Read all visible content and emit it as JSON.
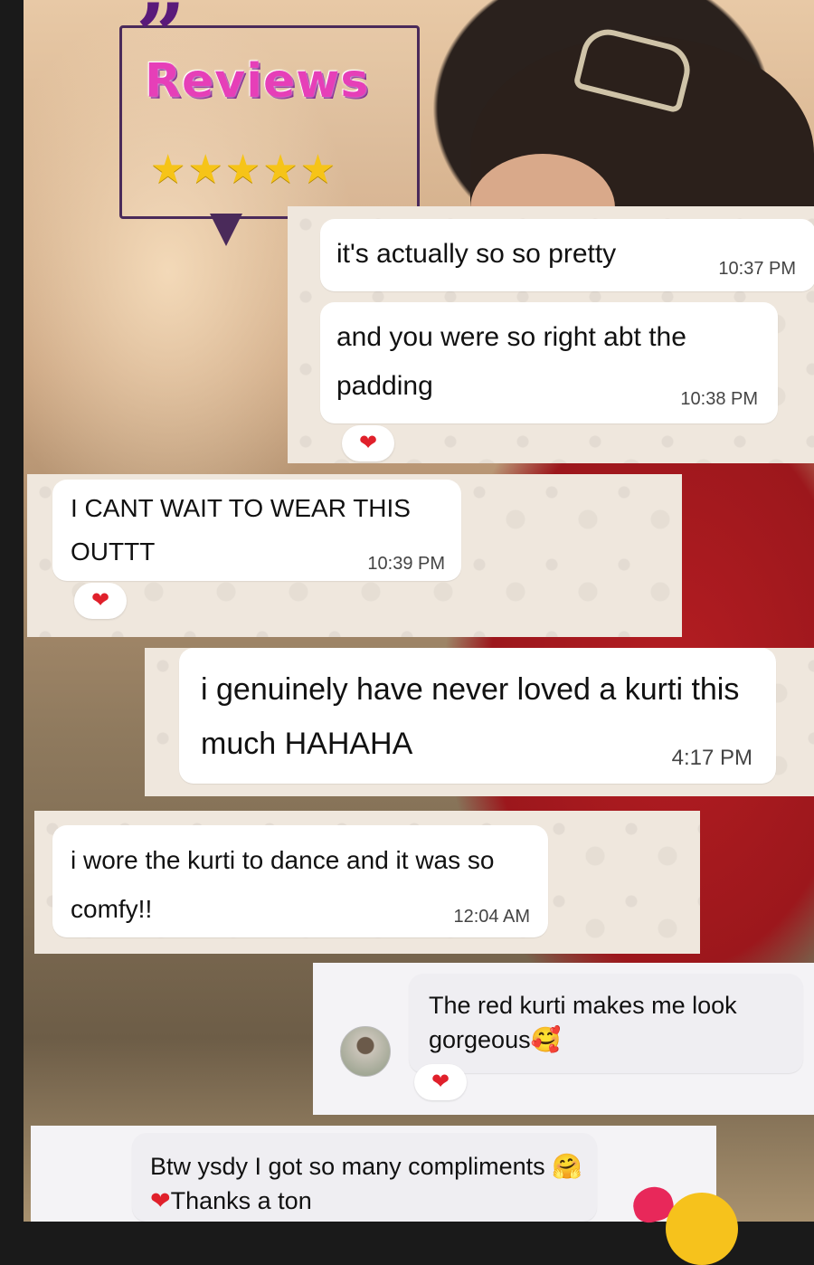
{
  "header": {
    "title": "Reviews",
    "rating_stars": "★★★★★",
    "quote_mark": "”"
  },
  "messages": [
    {
      "text": "it's actually so so pretty",
      "time": "10:37 PM"
    },
    {
      "text": "and you were so right abt the padding",
      "time": "10:38 PM",
      "reaction": "❤"
    },
    {
      "text": "I CANT WAIT TO WEAR THIS OUTTT",
      "time": "10:39 PM",
      "reaction": "❤"
    },
    {
      "text": "i genuinely have never loved a kurti this much HAHAHA",
      "time": "4:17 PM"
    },
    {
      "text": "i wore the kurti to dance and it was so comfy!!",
      "time": "12:04 AM"
    },
    {
      "text": "The red kurti makes me look gorgeous",
      "emoji": "🥰",
      "reaction": "❤"
    },
    {
      "text_a": "Btw ysdy I got so many compliments",
      "emoji_a": "🤗",
      "emoji_b": "❤",
      "text_b": "Thanks a ton"
    }
  ],
  "colors": {
    "accent_pink": "#e63fb8",
    "frame_purple": "#4a2a5a",
    "star_gold": "#f6c418",
    "reaction_red": "#e0202b"
  },
  "icons": [
    "heart-icon",
    "star-icon",
    "avatar",
    "quote-icon"
  ]
}
